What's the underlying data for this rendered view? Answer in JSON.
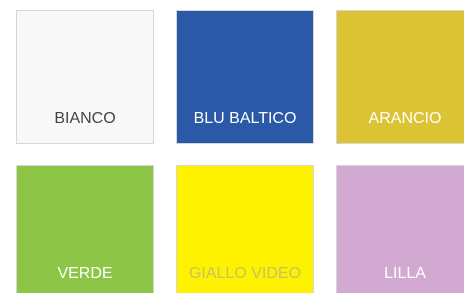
{
  "swatches": [
    {
      "label": "BIANCO",
      "color": "#f8f8f8",
      "text_color": "#444444"
    },
    {
      "label": "BLU BALTICO",
      "color": "#2a59a8",
      "text_color": "#ffffff"
    },
    {
      "label": "ARANCIO",
      "color": "#dcc333",
      "text_color": "#ffffff"
    },
    {
      "label": "VERDE",
      "color": "#8dc646",
      "text_color": "#ffffff"
    },
    {
      "label": "GIALLO VIDEO",
      "color": "#fff200",
      "text_color": "#c9bf6a"
    },
    {
      "label": "LILLA",
      "color": "#d2a9d1",
      "text_color": "#ffffff"
    }
  ]
}
